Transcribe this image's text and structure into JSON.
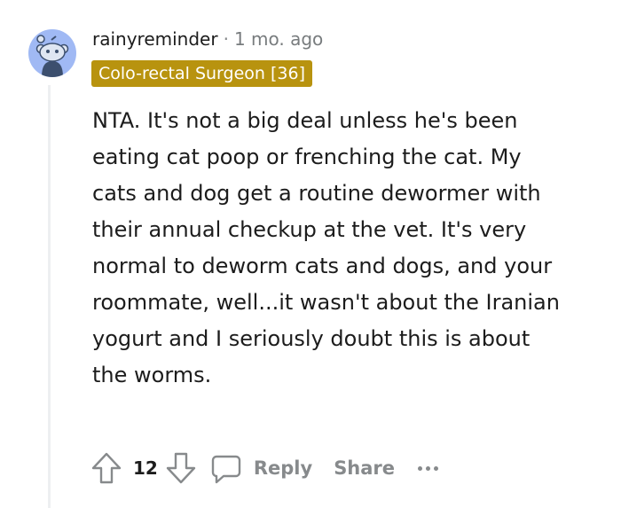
{
  "comment": {
    "author": "rainyreminder",
    "separator": "·",
    "timestamp": "1 mo. ago",
    "flair": "Colo-rectal Surgeon [36]",
    "flair_color": "#b8930f",
    "avatar_icon": "reddit-snoo-avatar",
    "body": "NTA. It's not a big deal unless he's been eating cat poop or frenching the cat. My cats and dog get a routine dewormer with their annual checkup at the vet. It's very normal to deworm cats and dogs, and your roommate, well...it wasn't about the Iranian yogurt and I seriously doubt this is about the worms.",
    "score": "12",
    "actions": {
      "reply": "Reply",
      "share": "Share"
    }
  }
}
